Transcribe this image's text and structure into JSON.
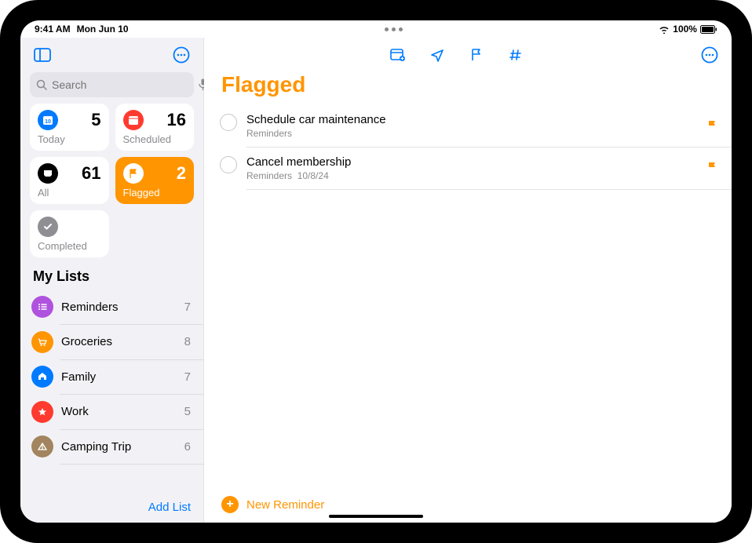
{
  "status": {
    "time": "9:41 AM",
    "date": "Mon Jun 10",
    "battery": "100%"
  },
  "search": {
    "placeholder": "Search"
  },
  "smart_lists": {
    "today": {
      "label": "Today",
      "count": "5",
      "color": "#007aff"
    },
    "scheduled": {
      "label": "Scheduled",
      "count": "16",
      "color": "#ff3b30"
    },
    "all": {
      "label": "All",
      "count": "61",
      "color": "#000000"
    },
    "flagged": {
      "label": "Flagged",
      "count": "2",
      "color": "#ffffff"
    },
    "completed": {
      "label": "Completed",
      "color": "#8e8e93"
    }
  },
  "lists_header": "My Lists",
  "my_lists": [
    {
      "name": "Reminders",
      "count": "7",
      "color": "#af52de"
    },
    {
      "name": "Groceries",
      "count": "8",
      "color": "#ff9500"
    },
    {
      "name": "Family",
      "count": "7",
      "color": "#007aff"
    },
    {
      "name": "Work",
      "count": "5",
      "color": "#ff3b30"
    },
    {
      "name": "Camping Trip",
      "count": "6",
      "color": "#a2845e"
    }
  ],
  "add_list_label": "Add List",
  "main": {
    "title": "Flagged",
    "reminders": [
      {
        "title": "Schedule car maintenance",
        "sublist": "Reminders",
        "date": ""
      },
      {
        "title": "Cancel membership",
        "sublist": "Reminders",
        "date": "10/8/24"
      }
    ],
    "new_reminder_label": "New Reminder"
  }
}
